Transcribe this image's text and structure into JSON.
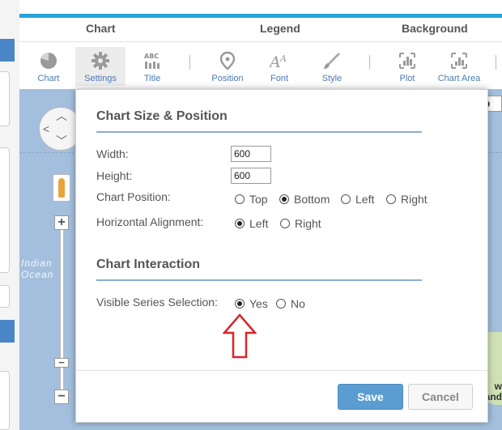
{
  "toolbar": {
    "groups": [
      "Chart",
      "Legend",
      "Background"
    ],
    "tools": [
      {
        "label": "Chart",
        "icon": "pie-chart-icon"
      },
      {
        "label": "Settings",
        "icon": "gear-icon",
        "active": true
      },
      {
        "label": "Title",
        "icon": "title-text-icon"
      },
      {
        "label": "Position",
        "icon": "location-pin-icon"
      },
      {
        "label": "Font",
        "icon": "font-icon"
      },
      {
        "label": "Style",
        "icon": "brush-icon"
      },
      {
        "label": "Plot",
        "icon": "plot-area-icon"
      },
      {
        "label": "Chart Area",
        "icon": "chart-area-icon"
      }
    ]
  },
  "map": {
    "ocean_label_line1": "Indian",
    "ocean_label_line2": "Ocean",
    "land_label_line1": "w",
    "land_label_line2": "and",
    "map_type_label": "ap"
  },
  "dialog": {
    "size_section_title": "Chart Size & Position",
    "width_label": "Width:",
    "width_value": "600",
    "height_label": "Height:",
    "height_value": "600",
    "chart_position_label": "Chart Position:",
    "chart_position_options": [
      "Top",
      "Bottom",
      "Left",
      "Right"
    ],
    "chart_position_selected": "Bottom",
    "horizontal_alignment_label": "Horizontal Alignment:",
    "horizontal_alignment_options": [
      "Left",
      "Right"
    ],
    "horizontal_alignment_selected": "Left",
    "interaction_section_title": "Chart Interaction",
    "visible_series_label": "Visible Series Selection:",
    "visible_series_options": [
      "Yes",
      "No"
    ],
    "visible_series_selected": "Yes",
    "save_label": "Save",
    "cancel_label": "Cancel"
  },
  "colors": {
    "accent": "#2aa1d8",
    "link": "#4a7ab5",
    "save_button": "#5b9dd1",
    "map_water": "#a3bfdd",
    "annotation_arrow": "#d9262a"
  }
}
